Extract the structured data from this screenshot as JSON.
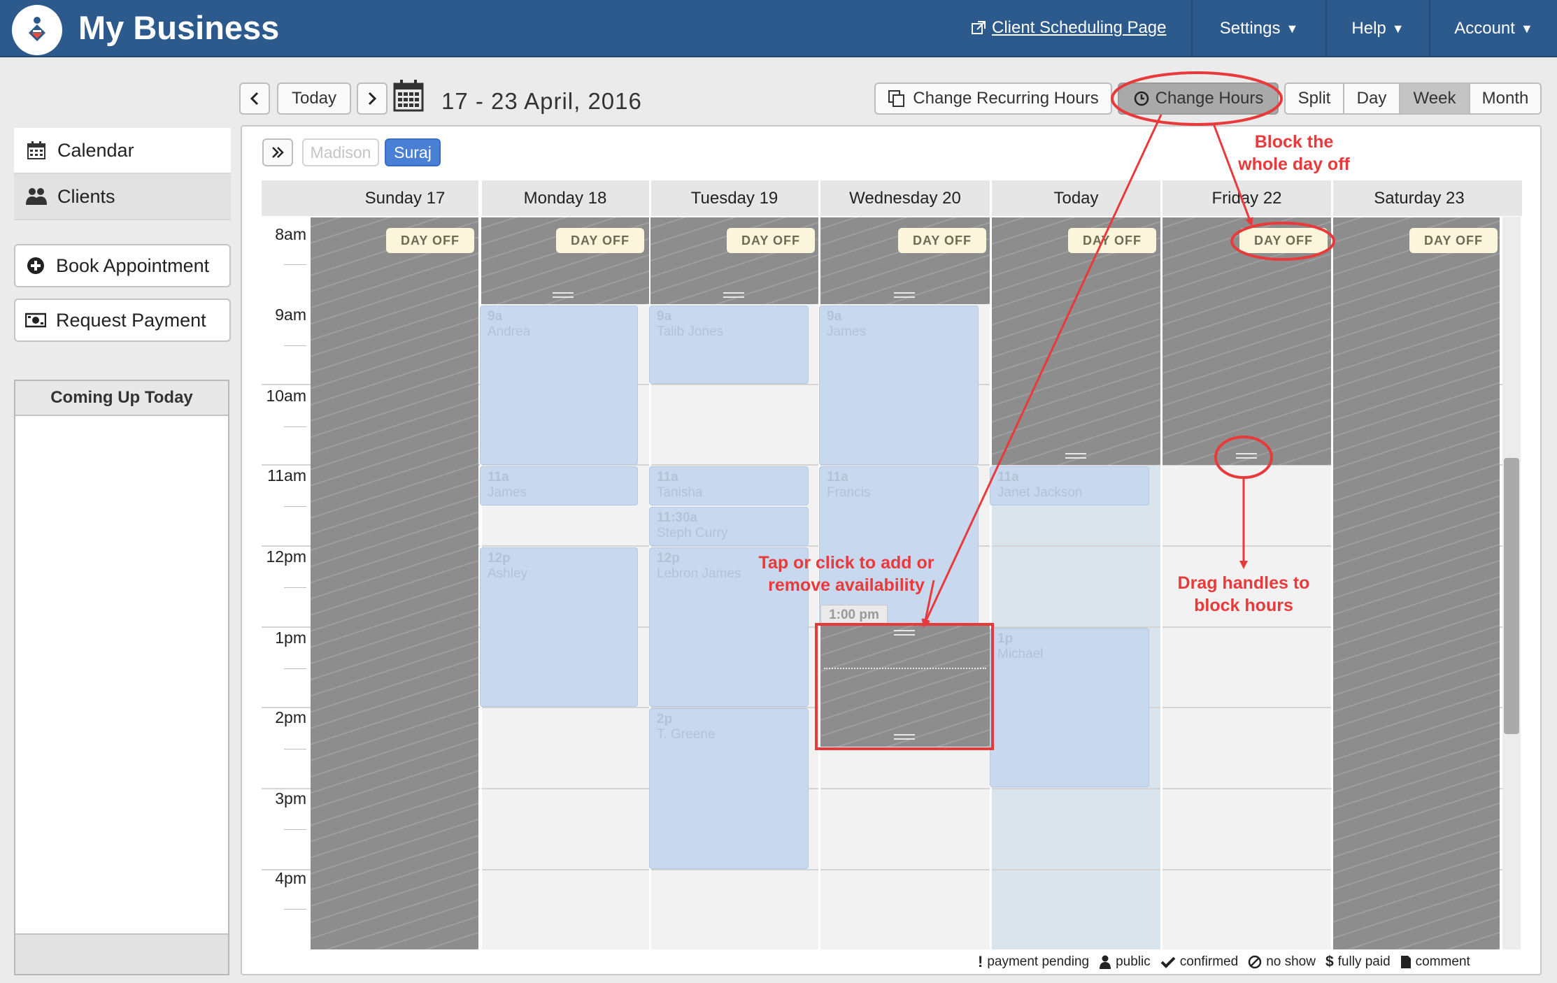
{
  "app": {
    "title": "My Business",
    "logo": "bowling-pin-logo"
  },
  "topnav": {
    "scheduling_link": "Client Scheduling Page",
    "settings": "Settings",
    "help": "Help",
    "account": "Account"
  },
  "toolbar": {
    "today": "Today",
    "date_range": "17 - 23 April, 2016",
    "change_recurring": "Change Recurring Hours",
    "change_hours": "Change Hours",
    "views": {
      "split": "Split",
      "day": "Day",
      "week": "Week",
      "month": "Month"
    },
    "active_view": "Week"
  },
  "sidebar": {
    "nav": {
      "calendar": "Calendar",
      "clients": "Clients"
    },
    "book": "Book Appointment",
    "payment": "Request Payment",
    "upcoming_title": "Coming Up Today"
  },
  "staff": {
    "madison": "Madison",
    "suraj": "Suraj"
  },
  "calendar": {
    "days": [
      "Sunday 17",
      "Monday 18",
      "Tuesday 19",
      "Wednesday 20",
      "Today",
      "Friday 22",
      "Saturday 23"
    ],
    "hours": [
      "8am",
      "9am",
      "10am",
      "11am",
      "12pm",
      "1pm",
      "2pm",
      "3pm",
      "4pm"
    ],
    "day_off_label": "DAY OFF",
    "drag_time": "1:00 pm",
    "appointments": {
      "mon_9a": {
        "time": "9a",
        "name": "Andrea"
      },
      "mon_11a": {
        "time": "11a",
        "name": "James"
      },
      "mon_12p": {
        "time": "12p",
        "name": "Ashley"
      },
      "tue_9a": {
        "time": "9a",
        "name": "Talib Jones"
      },
      "tue_11a": {
        "time": "11a",
        "name": "Tanisha"
      },
      "tue_1130a": {
        "time": "11:30a",
        "name": "Steph Curry"
      },
      "tue_12p": {
        "time": "12p",
        "name": "Lebron James"
      },
      "tue_2p": {
        "time": "2p",
        "name": "T. Greene"
      },
      "wed_9a": {
        "time": "9a",
        "name": "James"
      },
      "wed_11a": {
        "time": "11a",
        "name": "Francis"
      },
      "thu_11a": {
        "time": "11a",
        "name": "Janet Jackson"
      },
      "thu_1p": {
        "time": "1p",
        "name": "Michael"
      }
    }
  },
  "annotations": {
    "block_day": [
      "Block the",
      "whole day off"
    ],
    "tap_click": [
      "Tap or click to add or",
      "remove availability"
    ],
    "drag": [
      "Drag handles to",
      "block hours"
    ]
  },
  "legend": {
    "payment_pending": "payment pending",
    "public": "public",
    "confirmed": "confirmed",
    "no_show": "no show",
    "fully_paid": "fully paid",
    "comment": "comment"
  },
  "colors": {
    "header_bg": "#2d5a8c",
    "active_staff": "#4a7fd6",
    "annotation_red": "#e83a3a",
    "appointment_fill": "#c8d8ee",
    "blocked_gray": "#8d8d8d"
  }
}
